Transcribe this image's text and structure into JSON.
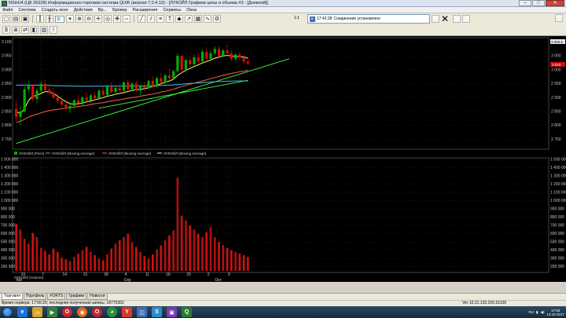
{
  "window": {
    "title": "NSHU4 (ЦБ 26228) Информационно-торговая система QUIK (версия 7.0.4.10) - [ЛУКОЙЛ Графики цены и объема #3 - [Дневной]]",
    "buttons": {
      "minimize": "–",
      "maximize": "□",
      "close": "✕"
    }
  },
  "menu": [
    "Файл",
    "Система",
    "Создать окно",
    "Действия",
    "Вр...",
    "Брокер",
    "Расширения",
    "Сервисы",
    "Окна"
  ],
  "toolbar": {
    "interval_value": "D",
    "ratio": "1:1",
    "connection_time": "17:42:28",
    "connection_status": "Соединение установлено"
  },
  "chart": {
    "price_label": "3 000,5",
    "last_price_label": "3 023",
    "legend": [
      "ЛУКОЙЛ [Price]",
      "ЛУКОЙЛ [Moving Average]",
      "ЛУКОЙЛ [Moving Average]",
      "ЛУКОЙЛ [Moving Average]"
    ],
    "volume_legend": "ЛУКОЙЛ [Volume]",
    "colors": {
      "background": "#000000",
      "up": "#00b000",
      "down": "#d01010",
      "ma_fast": "#ffff66",
      "ma_mid": "#ff6040",
      "ma_slow": "#40c0ff",
      "trend": "#40ff40"
    }
  },
  "chart_data": [
    {
      "type": "candlestick",
      "title": "",
      "y_ticks": [
        "3 100",
        "3 050",
        "3 000",
        "2 950",
        "2 900",
        "2 850",
        "2 800",
        "2 750"
      ],
      "ylim": [
        2720,
        3110
      ],
      "x_ticks": [
        "31",
        "7",
        "14",
        "21",
        "28",
        "4",
        "11",
        "18",
        "25",
        "2",
        "9"
      ],
      "x_groups": [
        "Авг",
        "Сер",
        "Окт"
      ],
      "candles": [
        {
          "o": 2860,
          "h": 2890,
          "l": 2815,
          "c": 2830
        },
        {
          "o": 2830,
          "h": 2870,
          "l": 2800,
          "c": 2850
        },
        {
          "o": 2850,
          "h": 2940,
          "l": 2845,
          "c": 2930
        },
        {
          "o": 2930,
          "h": 2960,
          "l": 2920,
          "c": 2945
        },
        {
          "o": 2945,
          "h": 2950,
          "l": 2885,
          "c": 2895
        },
        {
          "o": 2895,
          "h": 2935,
          "l": 2880,
          "c": 2925
        },
        {
          "o": 2925,
          "h": 2960,
          "l": 2915,
          "c": 2950
        },
        {
          "o": 2950,
          "h": 2965,
          "l": 2920,
          "c": 2928
        },
        {
          "o": 2928,
          "h": 2945,
          "l": 2910,
          "c": 2918
        },
        {
          "o": 2918,
          "h": 2935,
          "l": 2895,
          "c": 2900
        },
        {
          "o": 2900,
          "h": 2915,
          "l": 2880,
          "c": 2888
        },
        {
          "o": 2888,
          "h": 2905,
          "l": 2865,
          "c": 2875
        },
        {
          "o": 2875,
          "h": 2895,
          "l": 2850,
          "c": 2860
        },
        {
          "o": 2860,
          "h": 2885,
          "l": 2845,
          "c": 2870
        },
        {
          "o": 2870,
          "h": 2895,
          "l": 2860,
          "c": 2890
        },
        {
          "o": 2890,
          "h": 2910,
          "l": 2875,
          "c": 2880
        },
        {
          "o": 2880,
          "h": 2905,
          "l": 2870,
          "c": 2900
        },
        {
          "o": 2900,
          "h": 2920,
          "l": 2880,
          "c": 2890
        },
        {
          "o": 2890,
          "h": 2915,
          "l": 2880,
          "c": 2908
        },
        {
          "o": 2908,
          "h": 2925,
          "l": 2890,
          "c": 2898
        },
        {
          "o": 2898,
          "h": 2930,
          "l": 2890,
          "c": 2925
        },
        {
          "o": 2925,
          "h": 2940,
          "l": 2905,
          "c": 2910
        },
        {
          "o": 2910,
          "h": 2945,
          "l": 2905,
          "c": 2940
        },
        {
          "o": 2940,
          "h": 2955,
          "l": 2915,
          "c": 2920
        },
        {
          "o": 2920,
          "h": 2945,
          "l": 2910,
          "c": 2935
        },
        {
          "o": 2935,
          "h": 2950,
          "l": 2915,
          "c": 2925
        },
        {
          "o": 2925,
          "h": 2960,
          "l": 2920,
          "c": 2955
        },
        {
          "o": 2955,
          "h": 2965,
          "l": 2925,
          "c": 2930
        },
        {
          "o": 2930,
          "h": 2955,
          "l": 2925,
          "c": 2950
        },
        {
          "o": 2950,
          "h": 2960,
          "l": 2920,
          "c": 2925
        },
        {
          "o": 2925,
          "h": 2945,
          "l": 2910,
          "c": 2940
        },
        {
          "o": 2940,
          "h": 2955,
          "l": 2925,
          "c": 2935
        },
        {
          "o": 2935,
          "h": 2965,
          "l": 2930,
          "c": 2960
        },
        {
          "o": 2960,
          "h": 2975,
          "l": 2935,
          "c": 2940
        },
        {
          "o": 2940,
          "h": 2975,
          "l": 2935,
          "c": 2970
        },
        {
          "o": 2970,
          "h": 2990,
          "l": 2950,
          "c": 2955
        },
        {
          "o": 2955,
          "h": 2985,
          "l": 2945,
          "c": 2980
        },
        {
          "o": 2980,
          "h": 3005,
          "l": 2960,
          "c": 2970
        },
        {
          "o": 2970,
          "h": 3000,
          "l": 2965,
          "c": 2995
        },
        {
          "o": 2995,
          "h": 3060,
          "l": 2990,
          "c": 3050
        },
        {
          "o": 3050,
          "h": 3055,
          "l": 2990,
          "c": 3000
        },
        {
          "o": 3000,
          "h": 3040,
          "l": 2995,
          "c": 3035
        },
        {
          "o": 3035,
          "h": 3050,
          "l": 3010,
          "c": 3020
        },
        {
          "o": 3020,
          "h": 3055,
          "l": 3015,
          "c": 3045
        },
        {
          "o": 3045,
          "h": 3060,
          "l": 3020,
          "c": 3030
        },
        {
          "o": 3030,
          "h": 3075,
          "l": 3025,
          "c": 3065
        },
        {
          "o": 3065,
          "h": 3080,
          "l": 3030,
          "c": 3040
        },
        {
          "o": 3040,
          "h": 3070,
          "l": 3035,
          "c": 3060
        },
        {
          "o": 3060,
          "h": 3085,
          "l": 3055,
          "c": 3075
        },
        {
          "o": 3075,
          "h": 3085,
          "l": 3040,
          "c": 3050
        },
        {
          "o": 3050,
          "h": 3075,
          "l": 3045,
          "c": 3070
        },
        {
          "o": 3070,
          "h": 3090,
          "l": 3050,
          "c": 3060
        },
        {
          "o": 3060,
          "h": 3070,
          "l": 3030,
          "c": 3040
        },
        {
          "o": 3040,
          "h": 3060,
          "l": 3030,
          "c": 3055
        },
        {
          "o": 3055,
          "h": 3065,
          "l": 3035,
          "c": 3045
        },
        {
          "o": 3045,
          "h": 3055,
          "l": 3020,
          "c": 3030
        },
        {
          "o": 3030,
          "h": 3045,
          "l": 3015,
          "c": 3023
        }
      ],
      "ma_fast": [
        2850,
        2842,
        2860,
        2890,
        2905,
        2908,
        2915,
        2922,
        2920,
        2915,
        2905,
        2895,
        2885,
        2878,
        2876,
        2878,
        2880,
        2885,
        2888,
        2892,
        2896,
        2900,
        2905,
        2908,
        2912,
        2915,
        2918,
        2922,
        2926,
        2928,
        2930,
        2932,
        2936,
        2940,
        2944,
        2950,
        2955,
        2960,
        2966,
        2980,
        2990,
        2998,
        3005,
        3012,
        3018,
        3025,
        3030,
        3035,
        3042,
        3046,
        3050,
        3052,
        3050,
        3048,
        3047,
        3046,
        3042
      ],
      "ma_mid": [
        2810,
        2815,
        2822,
        2830,
        2836,
        2840,
        2845,
        2850,
        2853,
        2856,
        2858,
        2860,
        2862,
        2864,
        2866,
        2868,
        2870,
        2872,
        2875,
        2878,
        2880,
        2882,
        2885,
        2888,
        2890,
        2892,
        2895,
        2898,
        2900,
        2902,
        2905,
        2908,
        2910,
        2913,
        2916,
        2920,
        2923,
        2926,
        2930,
        2935,
        2940,
        2944,
        2948,
        2952,
        2956,
        2960,
        2964,
        2968,
        2972,
        2976,
        2980,
        2984,
        2987,
        2990,
        2993,
        2995,
        2998
      ],
      "ma_slow": [
        2945,
        2945,
        2945,
        2945,
        2945,
        2945,
        2944,
        2944,
        2944,
        2943,
        2943,
        2942,
        2942,
        2942,
        2941,
        2941,
        2941,
        2941,
        2941,
        2941,
        2941,
        2941,
        2941,
        2941,
        2941,
        2941,
        2941,
        2941,
        2942,
        2942,
        2942,
        2942,
        2943,
        2943,
        2943,
        2944,
        2944,
        2945,
        2946,
        2947,
        2948,
        2950,
        2951,
        2952,
        2953,
        2954,
        2955,
        2956,
        2957,
        2958,
        2958,
        2959,
        2959,
        2960,
        2960,
        2960,
        2960
      ],
      "trend_lines": [
        {
          "x0": 0,
          "y0": 2735,
          "x1": 66,
          "y1": 3040
        },
        {
          "x0": 20,
          "y0": 2862,
          "x1": 56,
          "y1": 2962
        }
      ]
    },
    {
      "type": "bar",
      "title": "",
      "y_ticks": [
        "1 500 000",
        "1 400 000",
        "1 300 000",
        "1 200 000",
        "1 100 000",
        "1 000 000",
        "900 000",
        "800 000",
        "700 000",
        "600 000",
        "500 000",
        "400 000",
        "300 000",
        "200 000"
      ],
      "ylim": [
        150000,
        1500000
      ],
      "values": [
        720000,
        650000,
        540000,
        480000,
        610000,
        560000,
        430000,
        390000,
        350000,
        420000,
        380000,
        310000,
        290000,
        270000,
        320000,
        360000,
        400000,
        440000,
        380000,
        340000,
        300000,
        280000,
        350000,
        420000,
        480000,
        520000,
        560000,
        600000,
        500000,
        440000,
        380000,
        330000,
        300000,
        350000,
        410000,
        460000,
        520000,
        580000,
        640000,
        1280000,
        820000,
        760000,
        700000,
        650000,
        600000,
        560000,
        620000,
        680000,
        560000,
        500000,
        460000,
        430000,
        400000,
        380000,
        360000,
        340000,
        320000
      ]
    }
  ],
  "tabs": [
    "Торговля",
    "Портфель",
    "FORTS",
    "Графики",
    "Новости"
  ],
  "status": {
    "left": "Время сервера: 17:56:20; последняя полученная запись: 18775352",
    "right": "Ver 10.21.133.155:15100"
  },
  "taskbar": {
    "time": "17:56",
    "date": "13.10.2017"
  }
}
